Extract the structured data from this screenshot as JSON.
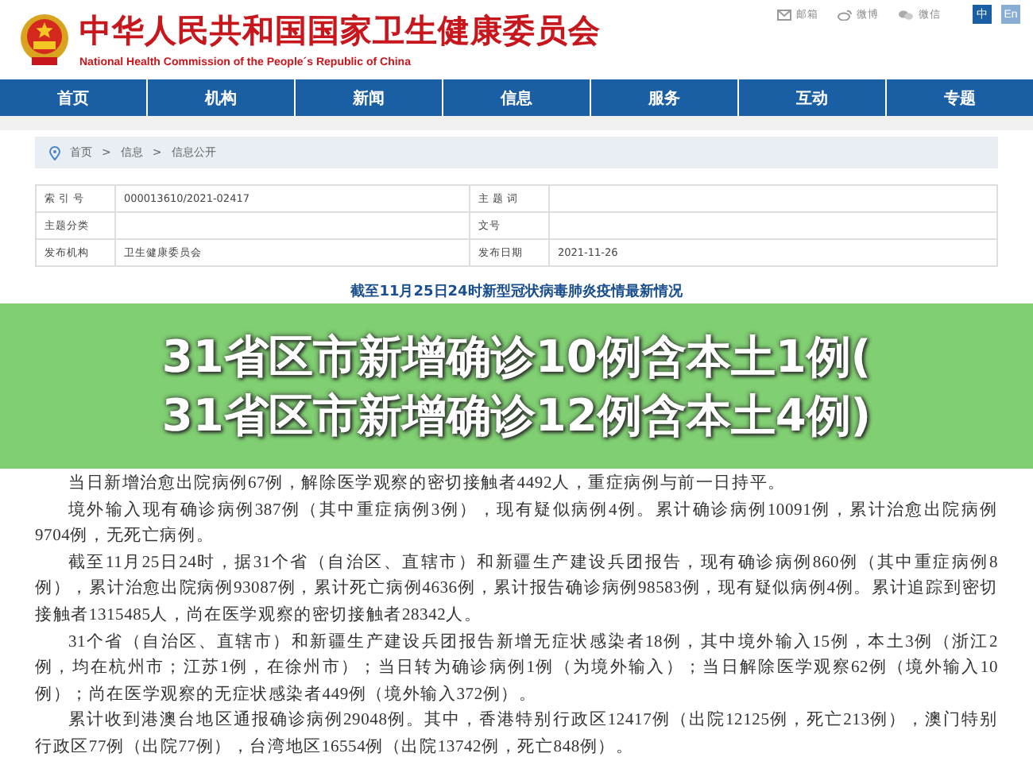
{
  "header": {
    "title": "中华人民共和国国家卫生健康委员会",
    "subtitle": "National Health Commission of the People´s Republic of China",
    "links": [
      {
        "kind": "mail",
        "label": "邮箱"
      },
      {
        "kind": "weibo",
        "label": "微博"
      },
      {
        "kind": "wechat",
        "label": "微信"
      }
    ],
    "languages": [
      {
        "label": "中",
        "selected": true
      },
      {
        "label": "En",
        "selected": false
      }
    ]
  },
  "nav": [
    {
      "label": "首页"
    },
    {
      "label": "机构"
    },
    {
      "label": "新闻"
    },
    {
      "label": "信息"
    },
    {
      "label": "服务"
    },
    {
      "label": "互动"
    },
    {
      "label": "专题"
    }
  ],
  "breadcrumb": [
    "首页",
    "信息",
    "信息公开"
  ],
  "breadcrumb_separator": ">",
  "meta_table": [
    {
      "label": "索 引 号",
      "value": "000013610/2021-02417",
      "label_2": "主 题 词"
    },
    {
      "label": "主题分类",
      "label_2": "文号"
    },
    {
      "label": "发布机构",
      "value": "卫生健康委员会",
      "label_2": "发布日期",
      "value_2": "2021-11-26"
    }
  ],
  "article": {
    "title": "截至11月25日24时新型冠状病毒肺炎疫情最新情况",
    "banner": [
      "31省区市新增确诊10例含本土1例(",
      "31省区市新增确诊12例含本土4例)"
    ],
    "paragraphs": [
      "当日新增治愈出院病例67例，解除医学观察的密切接触者4492人，重症病例与前一日持平。",
      "境外输入现有确诊病例387例（其中重症病例3例），现有疑似病例4例。累计确诊病例10091例，累计治愈出院病例9704例，无死亡病例。",
      "截至11月25日24时，据31个省（自治区、直辖市）和新疆生产建设兵团报告，现有确诊病例860例（其中重症病例8例），累计治愈出院病例93087例，累计死亡病例4636例，累计报告确诊病例98583例，现有疑似病例4例。累计追踪到密切接触者1315485人，尚在医学观察的密切接触者28342人。",
      "31个省（自治区、直辖市）和新疆生产建设兵团报告新增无症状感染者18例，其中境外输入15例，本土3例（浙江2例，均在杭州市；江苏1例，在徐州市）；当日转为确诊病例1例（为境外输入）；当日解除医学观察62例（境外输入10例）；尚在医学观察的无症状感染者449例（境外输入372例）。",
      "累计收到港澳台地区通报确诊病例29048例。其中，香港特别行政区12417例（出院12125例，死亡213例），澳门特别行政区77例（出院77例），台湾地区16554例（出院13742例，死亡848例）。"
    ]
  }
}
